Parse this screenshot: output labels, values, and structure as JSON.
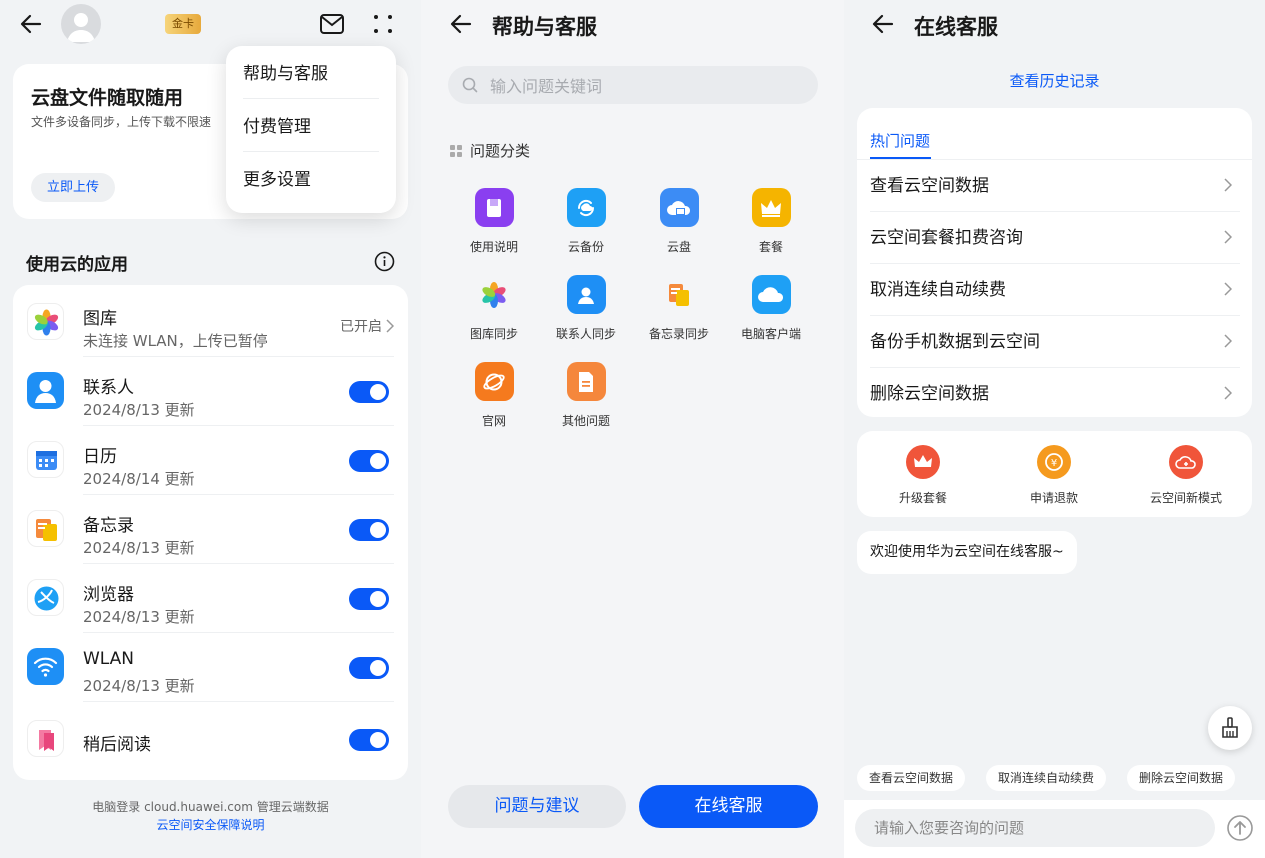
{
  "panel1": {
    "badge": "金卡",
    "menu": [
      "帮助与客服",
      "付费管理",
      "更多设置"
    ],
    "promo": {
      "title": "云盘文件随取随用",
      "subtitle": "文件多设备同步，上传下载不限速",
      "button": "立即上传"
    },
    "section_title": "使用云的应用",
    "apps": [
      {
        "name": "图库",
        "sub": "未连接 WLAN，上传已暂停",
        "status": "已开启",
        "icon": "gallery-icon"
      },
      {
        "name": "联系人",
        "sub": "2024/8/13 更新",
        "toggle": "on",
        "icon": "contacts-icon"
      },
      {
        "name": "日历",
        "sub": "2024/8/14 更新",
        "toggle": "on",
        "icon": "calendar-icon"
      },
      {
        "name": "备忘录",
        "sub": "2024/8/13 更新",
        "toggle": "on",
        "icon": "notes-icon"
      },
      {
        "name": "浏览器",
        "sub": "2024/8/13 更新",
        "toggle": "on",
        "icon": "browser-icon"
      },
      {
        "name": "WLAN",
        "sub": "2024/8/13 更新",
        "toggle": "on",
        "icon": "wlan-icon"
      },
      {
        "name": "稍后阅读",
        "sub": "",
        "toggle": "on",
        "icon": "read-later-icon"
      }
    ],
    "footer_line1": "电脑登录 cloud.huawei.com 管理云端数据",
    "footer_link": "云空间安全保障说明"
  },
  "panel2": {
    "title": "帮助与客服",
    "search_placeholder": "输入问题关键词",
    "category_title": "问题分类",
    "categories": [
      {
        "label": "使用说明",
        "color": "#8a3ff0",
        "icon": "manual-icon"
      },
      {
        "label": "云备份",
        "color": "#1ea0f5",
        "icon": "cloud-backup-icon"
      },
      {
        "label": "云盘",
        "color": "#3c8cf5",
        "icon": "cloud-drive-icon"
      },
      {
        "label": "套餐",
        "color": "#f5b400",
        "icon": "crown-icon"
      },
      {
        "label": "图库同步",
        "color": "#ffffff",
        "icon": "gallery-sync-icon"
      },
      {
        "label": "联系人同步",
        "color": "#1e8ff5",
        "icon": "contacts-sync-icon"
      },
      {
        "label": "备忘录同步",
        "color": "#ffffff",
        "icon": "notes-sync-icon"
      },
      {
        "label": "电脑客户端",
        "color": "#1ea0f5",
        "icon": "pc-client-icon"
      },
      {
        "label": "官网",
        "color": "#f57a1e",
        "icon": "website-icon"
      },
      {
        "label": "其他问题",
        "color": "#f5873c",
        "icon": "other-questions-icon"
      }
    ],
    "btn_feedback": "问题与建议",
    "btn_online": "在线客服"
  },
  "panel3": {
    "title": "在线客服",
    "history": "查看历史记录",
    "tab_hot": "热门问题",
    "questions": [
      "查看云空间数据",
      "云空间套餐扣费咨询",
      "取消连续自动续费",
      "备份手机数据到云空间",
      "删除云空间数据"
    ],
    "quick": [
      {
        "label": "升级套餐",
        "icon": "upgrade-crown-icon"
      },
      {
        "label": "申请退款",
        "icon": "refund-icon"
      },
      {
        "label": "云空间新模式",
        "icon": "cloud-new-mode-icon"
      }
    ],
    "welcome": "欢迎使用华为云空间在线客服~",
    "chips": [
      "查看云空间数据",
      "取消连续自动续费",
      "删除云空间数据"
    ],
    "input_placeholder": "请输入您要咨询的问题"
  },
  "colors": {
    "accent": "#0a59f7",
    "toggle_on": "#0a59f7",
    "background": "#f1f3f5"
  }
}
